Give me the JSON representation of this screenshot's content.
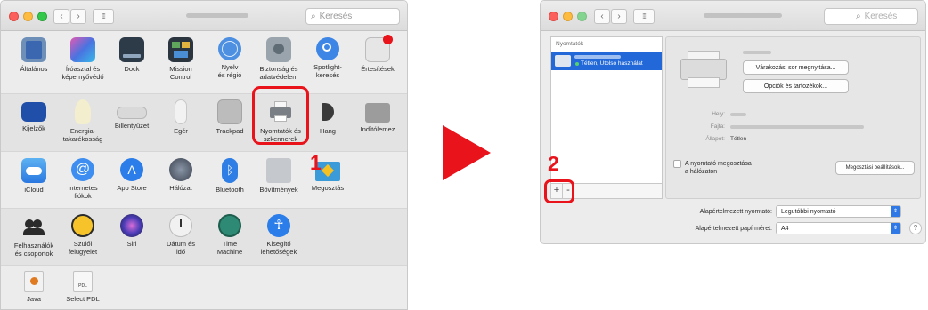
{
  "left_window": {
    "search_placeholder": "Keresés",
    "rows": [
      [
        {
          "label": "Általános",
          "icon": "general-icon"
        },
        {
          "label": "Íróasztal és\nképernyővédő",
          "icon": "desktop-icon"
        },
        {
          "label": "Dock",
          "icon": "dock-icon"
        },
        {
          "label": "Mission\nControl",
          "icon": "mission-control-icon"
        },
        {
          "label": "Nyelv\nés régió",
          "icon": "language-icon"
        },
        {
          "label": "Biztonság és\nadatvédelem",
          "icon": "security-icon"
        },
        {
          "label": "Spotlight-\nkeresés",
          "icon": "spotlight-icon"
        },
        {
          "label": "Értesítések",
          "icon": "notifications-icon"
        }
      ],
      [
        {
          "label": "Kijelzők",
          "icon": "displays-icon"
        },
        {
          "label": "Energia-\ntakarékosság",
          "icon": "energy-icon"
        },
        {
          "label": "Billentyűzet",
          "icon": "keyboard-icon"
        },
        {
          "label": "Egér",
          "icon": "mouse-icon"
        },
        {
          "label": "Trackpad",
          "icon": "trackpad-icon"
        },
        {
          "label": "Nyomtatók és\nszkennerek",
          "icon": "printer-icon"
        },
        {
          "label": "Hang",
          "icon": "sound-icon"
        },
        {
          "label": "Indítólemez",
          "icon": "startup-disk-icon"
        }
      ],
      [
        {
          "label": "iCloud",
          "icon": "icloud-icon"
        },
        {
          "label": "Internetes\nfiókok",
          "icon": "internet-accounts-icon"
        },
        {
          "label": "App Store",
          "icon": "app-store-icon"
        },
        {
          "label": "Hálózat",
          "icon": "network-icon"
        },
        {
          "label": "Bluetooth",
          "icon": "bluetooth-icon"
        },
        {
          "label": "Bővítmények",
          "icon": "extensions-icon"
        },
        {
          "label": "Megosztás",
          "icon": "sharing-icon"
        }
      ],
      [
        {
          "label": "Felhasználók\nés csoportok",
          "icon": "users-icon"
        },
        {
          "label": "Szülői\nfelügyelet",
          "icon": "parental-controls-icon"
        },
        {
          "label": "Siri",
          "icon": "siri-icon"
        },
        {
          "label": "Dátum és\nidő",
          "icon": "date-time-icon"
        },
        {
          "label": "Time\nMachine",
          "icon": "time-machine-icon"
        },
        {
          "label": "Kisegítő\nlehetőségek",
          "icon": "accessibility-icon"
        }
      ],
      [
        {
          "label": "Java",
          "icon": "java-icon"
        },
        {
          "label": "Select PDL",
          "icon": "select-pdl-icon"
        }
      ]
    ]
  },
  "steps": {
    "one": "1",
    "two": "2"
  },
  "right_window": {
    "search_placeholder": "Keresés",
    "list_header": "Nyomtatók",
    "printer_status": "Tétlen, Utolsó használat",
    "open_queue_button": "Várakozási sor megnyitása...",
    "options_button": "Opciók és tartozékok...",
    "location_label": "Hely:",
    "kind_label": "Fajta:",
    "state_label": "Állapot:",
    "state_value": "Tétlen",
    "share_checkbox_label": "A nyomtató megosztása\na hálózaton",
    "sharing_prefs_button": "Megosztási beállítások...",
    "add_button": "+",
    "remove_button": "-",
    "default_printer_label": "Alapértelmezett nyomtató:",
    "default_printer_value": "Legutóbbi nyomtató",
    "default_paper_label": "Alapértelmezett papírméret:",
    "default_paper_value": "A4",
    "help": "?"
  }
}
